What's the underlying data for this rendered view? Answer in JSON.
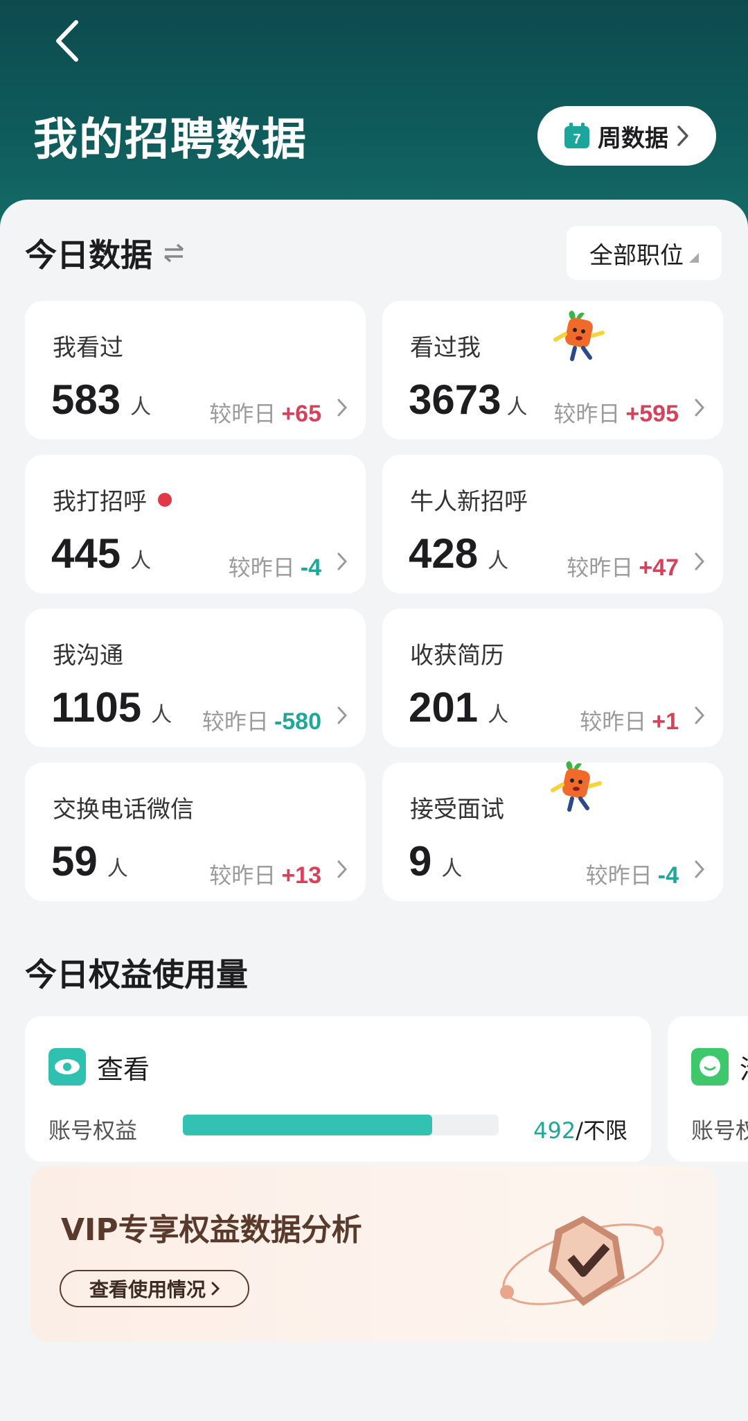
{
  "header": {
    "title": "我的招聘数据",
    "week_button": "周数据",
    "calendar_number": "7"
  },
  "today": {
    "title": "今日数据",
    "position_filter": "全部职位",
    "compare_label": "较昨日",
    "cards": [
      {
        "label": "我看过",
        "value": "583",
        "unit": "人",
        "delta": "+65",
        "trend": "up"
      },
      {
        "label": "看过我",
        "value": "3673",
        "unit": "人",
        "delta": "+595",
        "trend": "up"
      },
      {
        "label": "我打招呼",
        "value": "445",
        "unit": "人",
        "delta": "-4",
        "trend": "down",
        "dot": true
      },
      {
        "label": "牛人新招呼",
        "value": "428",
        "unit": "人",
        "delta": "+47",
        "trend": "up"
      },
      {
        "label": "我沟通",
        "value": "1105",
        "unit": "人",
        "delta": "-580",
        "trend": "down"
      },
      {
        "label": "收获简历",
        "value": "201",
        "unit": "人",
        "delta": "+1",
        "trend": "up"
      },
      {
        "label": "交换电话微信",
        "value": "59",
        "unit": "人",
        "delta": "+13",
        "trend": "up"
      },
      {
        "label": "接受面试",
        "value": "9",
        "unit": "人",
        "delta": "-4",
        "trend": "down"
      }
    ]
  },
  "quota": {
    "title": "今日权益使用量",
    "items": [
      {
        "name": "查看",
        "sub": "账号权益",
        "used": "492",
        "limit": "/不限",
        "progress": 0.79
      },
      {
        "name": "沟",
        "sub": "账号权益"
      }
    ]
  },
  "vip": {
    "title": "VIP专享权益数据分析",
    "button": "查看使用情况"
  },
  "colors": {
    "header_bg": "#0f5c5c",
    "up": "#d9415a",
    "down": "#1fa89a",
    "accent": "#33c1b2"
  }
}
